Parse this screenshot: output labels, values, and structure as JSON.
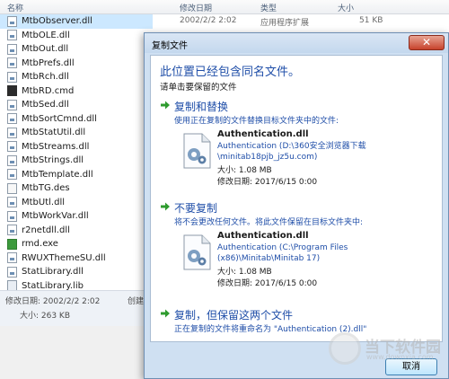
{
  "explorer": {
    "columns": {
      "name": "名称",
      "modified": "修改日期",
      "type": "类型",
      "size": "大小"
    },
    "top_row": {
      "date": "2002/2/2 2:02",
      "type": "应用程序扩展",
      "size": "51 KB"
    },
    "files": [
      {
        "name": "MtbObserver.dll",
        "icon": "dll-file-icon",
        "kind": "dll"
      },
      {
        "name": "MtbOLE.dll",
        "icon": "dll-file-icon",
        "kind": "dll"
      },
      {
        "name": "MtbOut.dll",
        "icon": "dll-file-icon",
        "kind": "dll"
      },
      {
        "name": "MtbPrefs.dll",
        "icon": "dll-file-icon",
        "kind": "dll"
      },
      {
        "name": "MtbRch.dll",
        "icon": "dll-file-icon",
        "kind": "dll"
      },
      {
        "name": "MtbRD.cmd",
        "icon": "cmd-file-icon",
        "kind": "cmd"
      },
      {
        "name": "MtbSed.dll",
        "icon": "dll-file-icon",
        "kind": "dll"
      },
      {
        "name": "MtbSortCmnd.dll",
        "icon": "dll-file-icon",
        "kind": "dll"
      },
      {
        "name": "MtbStatUtil.dll",
        "icon": "dll-file-icon",
        "kind": "dll"
      },
      {
        "name": "MtbStreams.dll",
        "icon": "dll-file-icon",
        "kind": "dll"
      },
      {
        "name": "MtbStrings.dll",
        "icon": "dll-file-icon",
        "kind": "dll"
      },
      {
        "name": "MtbTemplate.dll",
        "icon": "dll-file-icon",
        "kind": "dll"
      },
      {
        "name": "MtbTG.des",
        "icon": "des-file-icon",
        "kind": "des"
      },
      {
        "name": "MtbUtl.dll",
        "icon": "dll-file-icon",
        "kind": "dll"
      },
      {
        "name": "MtbWorkVar.dll",
        "icon": "dll-file-icon",
        "kind": "dll"
      },
      {
        "name": "r2netdll.dll",
        "icon": "dll-file-icon",
        "kind": "dll"
      },
      {
        "name": "rmd.exe",
        "icon": "exe-file-icon",
        "kind": "exe"
      },
      {
        "name": "RWUXThemeSU.dll",
        "icon": "dll-file-icon",
        "kind": "dll"
      },
      {
        "name": "StatLibrary.dll",
        "icon": "dll-file-icon",
        "kind": "dll"
      },
      {
        "name": "StatLibrary.lib",
        "icon": "lib-file-icon",
        "kind": "lib"
      }
    ],
    "status": {
      "modified": "修改日期: 2002/2/2 2:02",
      "created": "创建",
      "size": "大小: 263 KB"
    }
  },
  "dialog": {
    "title": "复制文件",
    "close_label": "✕",
    "heading": "此位置已经包含同名文件。",
    "subheading": "请单击要保留的文件",
    "options": [
      {
        "title": "复制和替换",
        "desc": "使用正在复制的文件替换目标文件夹中的文件:",
        "file": {
          "name": "Authentication.dll",
          "path": "Authentication (D:\\360安全浏览器下载\\minitab18pjb_jz5u.com)",
          "size": "大小: 1.08 MB",
          "date": "修改日期: 2017/6/15 0:00"
        }
      },
      {
        "title": "不要复制",
        "desc": "将不会更改任何文件。将此文件保留在目标文件夹中:",
        "file": {
          "name": "Authentication.dll",
          "path": "Authentication (C:\\Program Files (x86)\\Minitab\\Minitab 17)",
          "size": "大小: 1.08 MB",
          "date": "修改日期: 2017/6/15 0:00"
        }
      },
      {
        "title": "复制，但保留这两个文件",
        "desc": "正在复制的文件将重命名为 \"Authentication (2).dll\""
      }
    ],
    "cancel_label": "取消"
  },
  "watermark": {
    "text": "当下软件园",
    "url": "www.downxia.com"
  },
  "colors": {
    "link_blue": "#1f4ea8",
    "arrow_green": "#2e9b2e",
    "dialog_frame": "#cfe0f2"
  }
}
